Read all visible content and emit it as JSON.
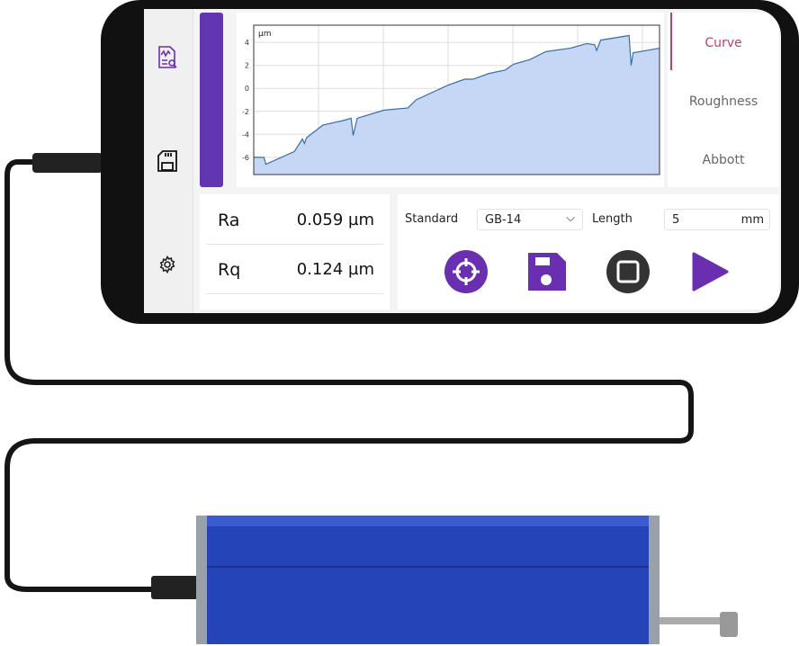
{
  "colors": {
    "accent": "#6a2fb0",
    "tab_active": "#c0406a",
    "chart_fill": "#c6d6f5",
    "chart_line": "#3a6ea5",
    "stop_button": "#333333",
    "device": "#2040b0"
  },
  "sidebar": {
    "items": [
      {
        "icon": "report-search-icon"
      },
      {
        "icon": "sd-card-icon"
      },
      {
        "icon": "gear-icon"
      }
    ]
  },
  "tabs": [
    {
      "label": "Curve",
      "active": true
    },
    {
      "label": "Roughness",
      "active": false
    },
    {
      "label": "Abbott",
      "active": false
    }
  ],
  "results": [
    {
      "name": "Ra",
      "value": "0.059 µm"
    },
    {
      "name": "Rq",
      "value": "0.124 µm"
    }
  ],
  "controls": {
    "standard_label": "Standard",
    "standard_value": "GB-14",
    "length_label": "Length",
    "length_value": "5",
    "length_unit": "mm",
    "buttons": [
      {
        "icon": "crosshair-icon"
      },
      {
        "icon": "save-icon"
      },
      {
        "icon": "stop-icon"
      },
      {
        "icon": "play-icon"
      }
    ]
  },
  "chart_data": {
    "type": "area",
    "ylabel": "µm",
    "ylim": [
      -7.5,
      5.5
    ],
    "yticks": [
      4,
      2,
      0,
      -2,
      -4,
      -6
    ],
    "grid": true,
    "x": [
      0,
      2.5,
      3,
      10,
      12,
      12.5,
      13,
      17,
      22,
      24,
      24.5,
      25.5,
      32,
      38,
      40,
      48,
      52,
      54,
      58,
      62,
      64,
      68,
      72,
      78,
      82,
      84,
      84.5,
      85.5,
      92.5,
      93,
      93.5,
      100
    ],
    "y": [
      -6,
      -6,
      -6.6,
      -5.5,
      -4.4,
      -4.8,
      -4.3,
      -3.2,
      -2.8,
      -2.6,
      -4.1,
      -2.6,
      -1.9,
      -1.7,
      -1,
      0.3,
      0.8,
      0.8,
      1.3,
      1.6,
      2.1,
      2.5,
      3.2,
      3.5,
      3.9,
      3.8,
      3.3,
      4.2,
      4.6,
      2,
      3.1,
      3.5
    ]
  }
}
